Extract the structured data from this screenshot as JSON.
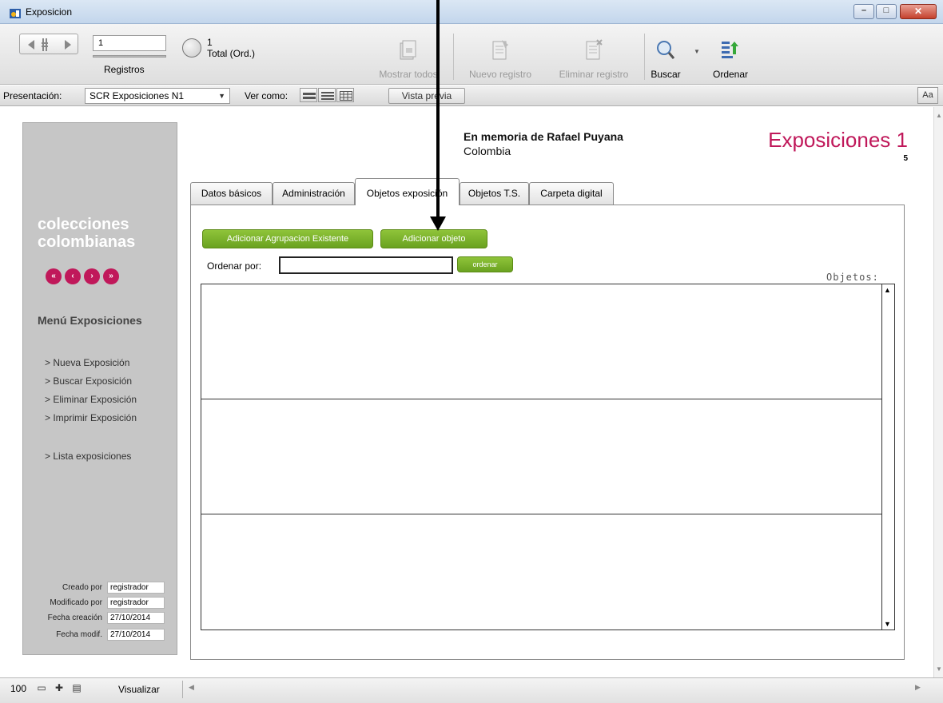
{
  "window": {
    "title": "Exposicion",
    "controls": {
      "minimize": "–",
      "maximize": "□",
      "close": "✕"
    }
  },
  "toolbar": {
    "record_number": "1",
    "records_label": "Registros",
    "found_count": "1",
    "total_label": "Total (Ord.)",
    "buttons": {
      "show_all": "Mostrar todos",
      "new_record": "Nuevo registro",
      "delete_record": "Eliminar registro",
      "find": "Buscar",
      "sort": "Ordenar"
    }
  },
  "layout_bar": {
    "layout_label": "Presentación:",
    "layout_value": "SCR Exposiciones N1",
    "view_as_label": "Ver como:",
    "preview_button": "Vista previa",
    "text_button": "Aa"
  },
  "sidebar": {
    "brand": "colecciones colombianas",
    "nav": [
      "«",
      "‹",
      "›",
      "»"
    ],
    "menu_title": "Menú Exposiciones",
    "menu_items": [
      "> Nueva Exposición",
      "> Buscar Exposición",
      "> Eliminar Exposición",
      "> Imprimir Exposición",
      "> Lista exposiciones"
    ],
    "meta": {
      "created_by_label": "Creado por",
      "created_by": "registrador",
      "modified_by_label": "Modificado por",
      "modified_by": "registrador",
      "created_date_label": "Fecha creación",
      "created_date": "27/10/2014",
      "modified_date_label": "Fecha modif.",
      "modified_date": "27/10/2014"
    }
  },
  "header": {
    "memoria": "En memoria de Rafael Puyana",
    "country": "Colombia",
    "title": "Exposiciones 1",
    "record_id": "5"
  },
  "tabs": [
    {
      "label": "Datos básicos"
    },
    {
      "label": "Administración"
    },
    {
      "label": "Objetos exposición",
      "active": true
    },
    {
      "label": "Objetos T.S."
    },
    {
      "label": "Carpeta digital"
    }
  ],
  "objects_tab": {
    "add_group_button": "Adicionar Agrupacion Existente",
    "add_object_button": "Adicionar objeto",
    "sort_label": "Ordenar por:",
    "sort_value": "",
    "sort_button": "ordenar",
    "objects_label": "Objetos:"
  },
  "statusbar": {
    "zoom": "100",
    "mode": "Visualizar"
  },
  "colors": {
    "accent": "#c0185a",
    "button_green": "#76ad28",
    "sidebar_gray": "#c6c6c6"
  },
  "icons": [
    "book-icon",
    "pie-icon",
    "show-all-icon",
    "new-record-icon",
    "delete-record-icon",
    "search-icon",
    "sort-icon"
  ]
}
